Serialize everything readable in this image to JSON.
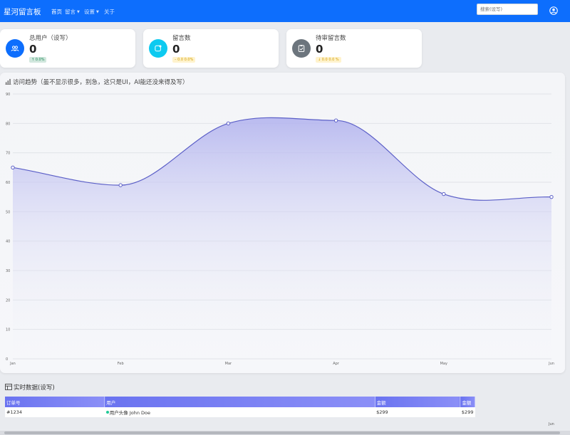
{
  "navbar": {
    "brand": "星河留言板",
    "links": [
      {
        "label": "首页",
        "active": true
      },
      {
        "label": "留言",
        "dropdown": true
      },
      {
        "label": "设置",
        "dropdown": true
      },
      {
        "label": "关于"
      }
    ],
    "search_placeholder": "搜索(设写)",
    "user_icon": "user-circle-icon"
  },
  "stats": [
    {
      "label": "总用户（设写）",
      "value": "0",
      "badge": "↑ 0.0%",
      "icon": "users-icon",
      "color": "#0d6efd"
    },
    {
      "label": "留言数",
      "value": "0",
      "badge": "– 0.0 0.0%",
      "icon": "message-icon",
      "color": "#0dcaf0"
    },
    {
      "label": "待审留言数",
      "value": "0",
      "badge": "↓ 0.0 0.0 %",
      "icon": "clipboard-icon",
      "color": "#6c757d"
    }
  ],
  "chart": {
    "title": "访问趋势（虽不显示很多，别急，这只是UI，AI能还没来得及写）",
    "icon": "bar-chart-icon"
  },
  "chart_data": {
    "type": "area",
    "categories": [
      "Jan",
      "Feb",
      "Mar",
      "Apr",
      "May",
      "Jun"
    ],
    "values": [
      65,
      59,
      80,
      81,
      56,
      55
    ],
    "ylim": [
      0,
      90
    ],
    "yticks": [
      0,
      10,
      20,
      30,
      40,
      50,
      60,
      70,
      80,
      90
    ],
    "grid": true,
    "line_color": "#5b5fc7",
    "fill_color": "#b8b9f0",
    "title": "",
    "xlabel": "",
    "ylabel": ""
  },
  "table": {
    "title": "实时数据(设写)",
    "icon": "table-icon",
    "headers": [
      "订单号",
      "用户",
      "金额",
      "金额"
    ],
    "rows": [
      {
        "order": "#1234",
        "user": "用户头像 John Doe",
        "amount": "$299",
        "amount2": "$299"
      }
    ],
    "overflow_label": "Jun"
  }
}
